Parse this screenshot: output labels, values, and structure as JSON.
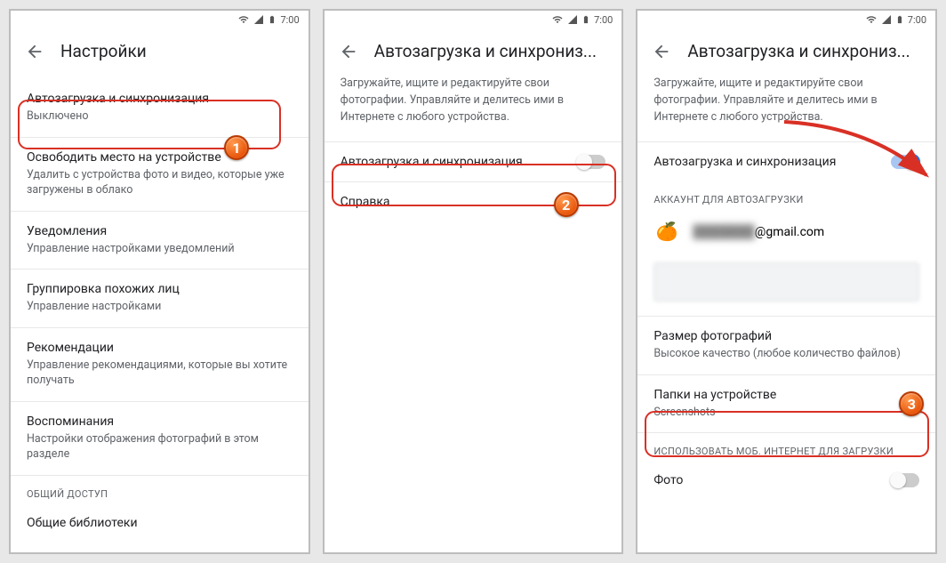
{
  "status": {
    "time": "7:00"
  },
  "screen1": {
    "title": "Настройки",
    "items": [
      {
        "label": "Автозагрузка и синхронизация",
        "sub": "Выключено"
      },
      {
        "label": "Освободить место на устройстве",
        "sub": "Удалить с устройства фото и видео, которые уже загружены в облако"
      },
      {
        "label": "Уведомления",
        "sub": "Управление настройками уведомлений"
      },
      {
        "label": "Группировка похожих лиц",
        "sub": "Управление настройками"
      },
      {
        "label": "Рекомендации",
        "sub": "Управление рекомендациями, которые вы хотите получать"
      },
      {
        "label": "Воспоминания",
        "sub": "Настройки отображения фотографий в этом разделе"
      }
    ],
    "section_header": "ОБЩИЙ ДОСТУП",
    "last": "Общие библиотеки"
  },
  "screen2": {
    "title": "Автозагрузка и синхрониз...",
    "desc": "Загружайте, ищите и редактируйте свои фотографии. Управляйте и делитесь ими в Интернете с любого устройства.",
    "toggle_label": "Автозагрузка и синхронизация",
    "help": "Справка"
  },
  "screen3": {
    "title": "Автозагрузка и синхрониз...",
    "desc": "Загружайте, ищите и редактируйте свои фотографии. Управляйте и делитесь ими в Интернете с любого устройства.",
    "toggle_label": "Автозагрузка и синхронизация",
    "account_header": "АККАУНТ ДЛЯ АВТОЗАГРУЗКИ",
    "email_hidden": "███████",
    "email_domain": "@gmail.com",
    "size_label": "Размер фотографий",
    "size_sub": "Высокое качество (любое количество файлов)",
    "folders_label": "Папки на устройстве",
    "folders_sub": "Screenshots",
    "mobile_header": "ИСПОЛЬЗОВАТЬ МОБ. ИНТЕРНЕТ ДЛЯ ЗАГРУЗКИ",
    "photo_label": "Фото"
  },
  "badges": {
    "b1": "1",
    "b2": "2",
    "b3": "3"
  }
}
